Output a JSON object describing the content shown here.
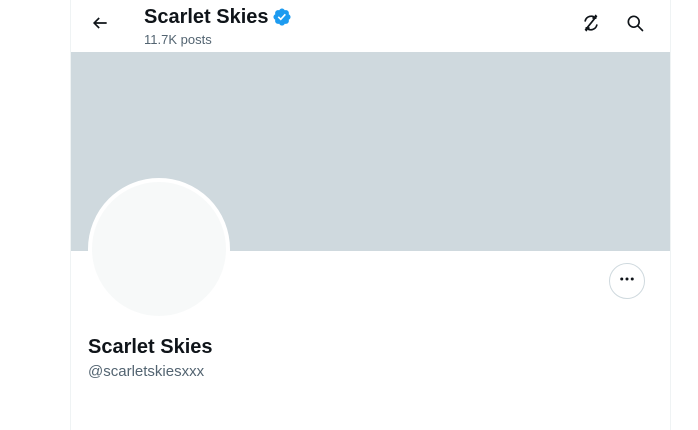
{
  "header": {
    "title": "Scarlet Skies",
    "posts_count": "11.7K posts",
    "back_icon": "arrow-left-icon",
    "verified_icon": "verified-badge-icon",
    "right_icons": [
      "unfollow-no-sync-icon",
      "search-icon"
    ]
  },
  "profile": {
    "display_name": "Scarlet Skies",
    "handle": "@scarletskiesxxx",
    "more_icon": "more-options-icon"
  },
  "colors": {
    "banner": "#cfd9de",
    "verified": "#1d9bf0",
    "text_primary": "#0f1419",
    "text_secondary": "#536471"
  }
}
